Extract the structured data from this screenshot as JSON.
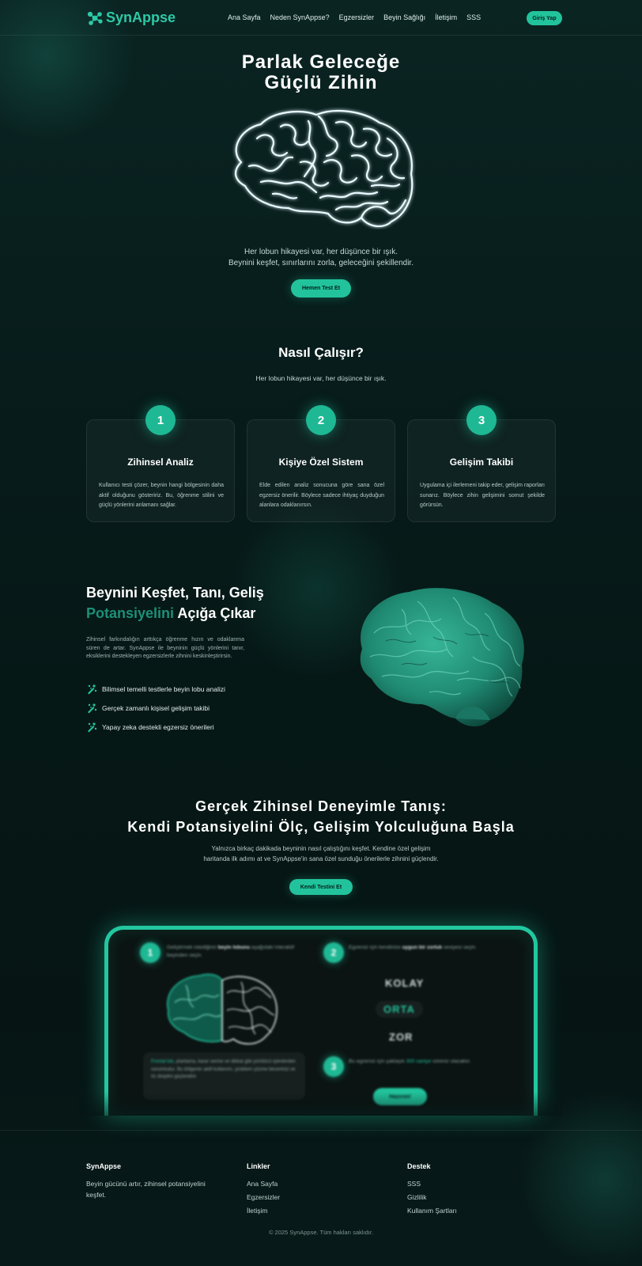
{
  "nav": {
    "logo": "SynAppse",
    "links": [
      "Ana Sayfa",
      "Neden SynAppse?",
      "Egzersizler",
      "Beyin Sağlığı",
      "İletişim",
      "SSS"
    ],
    "login": "Giriş Yap"
  },
  "hero": {
    "title_line1": "Parlak Geleceğe",
    "title_line2": "Güçlü Zihin",
    "sub_line1": "Her lobun hikayesi var, her düşünce bir ışık.",
    "sub_line2": "Beynini keşfet, sınırlarını zorla, geleceğini şekillendir.",
    "cta": "Hemen Test Et"
  },
  "how": {
    "title": "Nasıl Çalışır?",
    "subtitle": "Her lobun hikayesi var, her düşünce bir ışık.",
    "cards": [
      {
        "num": "1",
        "title": "Zihinsel Analiz",
        "text": "Kullanıcı testi çözer, beynin hangi bölgesinin daha aktif olduğunu gösteririz. Bu, öğrenme stilini ve güçlü yönlerini anlamanı sağlar."
      },
      {
        "num": "2",
        "title": "Kişiye Özel Sistem",
        "text": "Elde edilen analiz sonucuna göre sana özel egzersiz önerilir. Böylece sadece ihtiyaç duyduğun alanlara odaklanırsın."
      },
      {
        "num": "3",
        "title": "Gelişim Takibi",
        "text": "Uygulama içi ilerlemeni takip eder, gelişim raporları sunarız. Böylece zihin gelişimini somut şekilde görürsün."
      }
    ]
  },
  "explore": {
    "title_line1": "Beynini Keşfet, Tanı, Geliş",
    "title_hl": "Potansiyelini",
    "title_rest": " Açığa Çıkar",
    "text": "Zihinsel farkındalığın arttıkça öğrenme hızın ve odaklanma süren de artar. SynAppse ile beyninin güçlü yönlerini tanır, eksiklerini destekleyen egzersizlerle zihnini keskinleştirirsin.",
    "features": [
      "Bilimsel temelli testlerle beyin lobu analizi",
      "Gerçek zamanlı kişisel gelişim takibi",
      "Yapay zeka destekli egzersiz önerileri"
    ]
  },
  "experience": {
    "title_line1": "Gerçek Zihinsel Deneyimle Tanış:",
    "title_line2": "Kendi Potansiyelini Ölç, Gelişim Yolculuğuna Başla",
    "sub_line1": "Yalnızca birkaç dakikada beyninin nasıl çalıştığını keşfet. Kendine özel gelişim",
    "sub_line2": "haritanda ilk adımı at ve SynAppse'in sana özel sunduğu önerilerle zihnini güçlendir.",
    "cta": "Kendi Testini Et"
  },
  "demo": {
    "step1": "1",
    "step1_pre": "Geliştirmek istediğiniz ",
    "step1_bold": "beyin lobunu",
    "step1_post": " aşağıdaki interaktif beyinden seçin.",
    "step2": "2",
    "step2_pre": "Egzersiz için kendinize ",
    "step2_bold": "uygun bir zorluk",
    "step2_post": " seviyesi seçin.",
    "levels": [
      "KOLAY",
      "ORTA",
      "ZOR"
    ],
    "step3": "3",
    "step3_pre": "Bu egzersiz için yaklaşık ",
    "step3_hl": "300 saniye",
    "step3_post": " süreniz olacaktır.",
    "note_hl": "Frontal lob,",
    "note_text": " planlama, karar verme ve dikkat gibi yürütücü işlevlerden sorumludur. Bu bölgenin aktif kullanımı, problem çözme becerinizi ve öz disiplini güçlendirir.",
    "start": "Hazırım!"
  },
  "footer": {
    "brand": "SynAppse",
    "brand_desc": "Beyin gücünü artır, zihinsel potansiyelini keşfet.",
    "links_title": "Linkler",
    "links": [
      "Ana Sayfa",
      "Egzersizler",
      "İletişim"
    ],
    "support_title": "Destek",
    "support": [
      "SSS",
      "Gizlilik",
      "Kullanım Şartları"
    ],
    "copyright": "© 2025 SynAppse. Tüm hakları saklıdır."
  },
  "colors": {
    "accent": "#22c39c",
    "background": "#061716",
    "text": "#ffffff"
  },
  "icons": {
    "logo": "molecule-icon",
    "feature": "brain-sparkle-icon"
  }
}
